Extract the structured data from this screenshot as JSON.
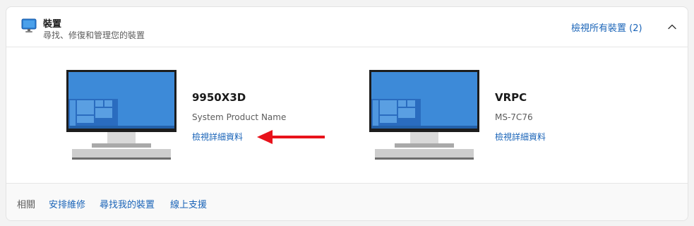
{
  "header": {
    "title": "裝置",
    "subtitle": "尋找、修復和管理您的裝置",
    "view_all_link": "檢視所有裝置 (2)",
    "icon": "monitor-icon",
    "collapse_icon": "chevron-up-icon"
  },
  "devices": [
    {
      "name": "9950X3D",
      "model": "System Product Name",
      "details_link": "檢視詳細資料",
      "icon": "desktop-pc-icon"
    },
    {
      "name": "VRPC",
      "model": "MS-7C76",
      "details_link": "檢視詳細資料",
      "icon": "desktop-pc-icon"
    }
  ],
  "footer": {
    "label": "相關",
    "links": [
      "安排維修",
      "尋找我的裝置",
      "線上支援"
    ]
  },
  "annotation": {
    "icon": "red-arrow-icon",
    "color": "#e8121b"
  },
  "colors": {
    "link": "#1a64b8",
    "screen": "#3d8ad8",
    "screen_dark": "#2a6cbf"
  }
}
